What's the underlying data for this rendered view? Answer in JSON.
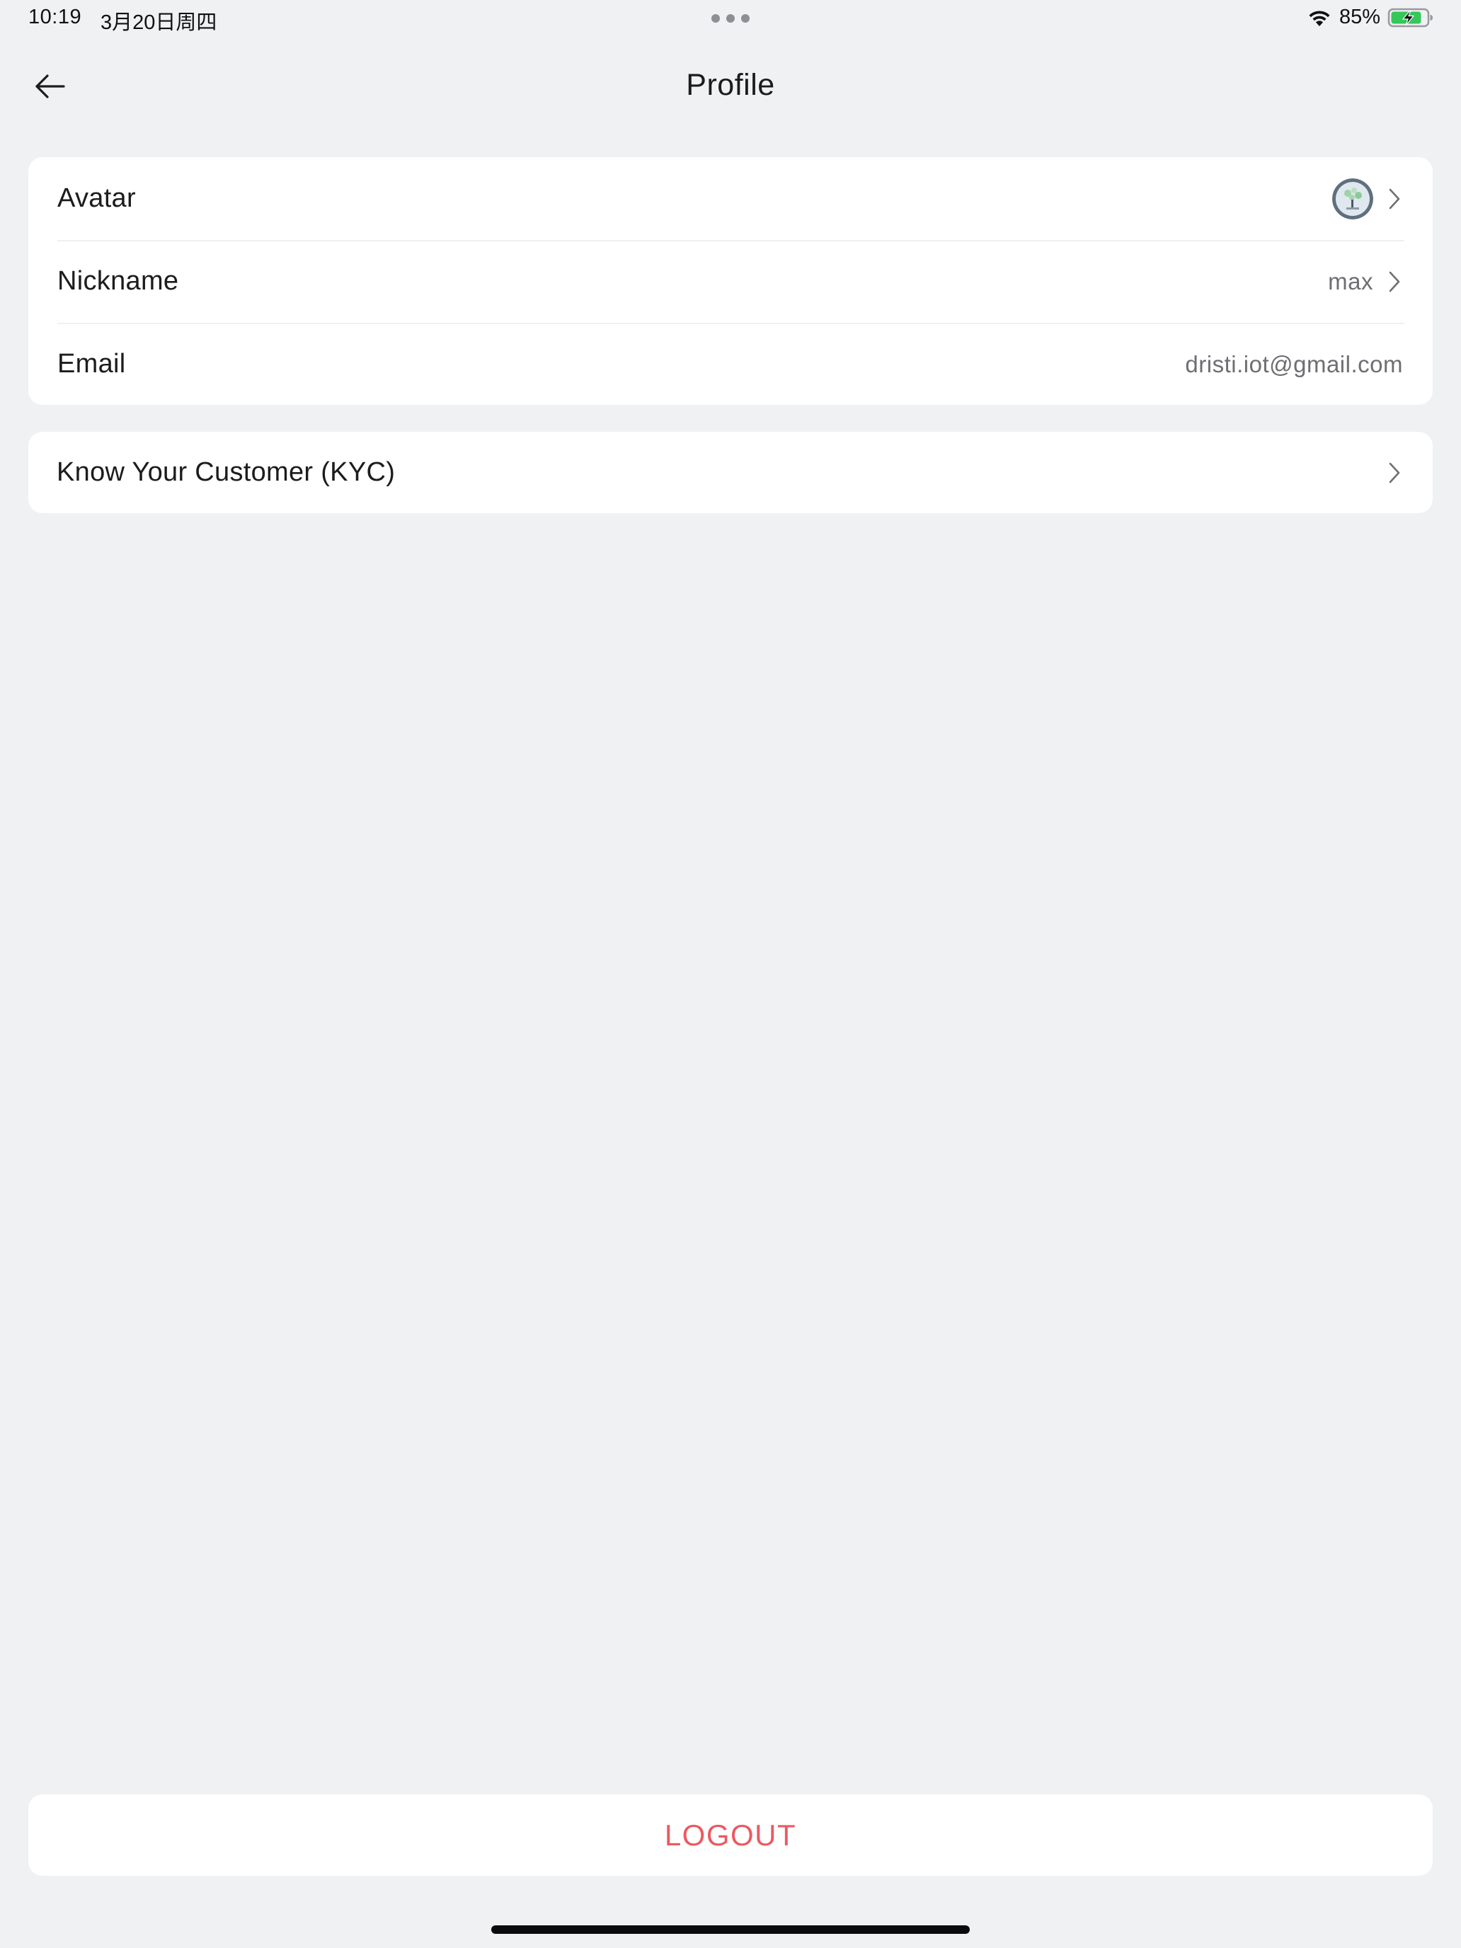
{
  "status_bar": {
    "time": "10:19",
    "date": "3月20日周四",
    "battery_percent": "85%",
    "battery_level": 0.85,
    "battery_color": "#34c759"
  },
  "nav": {
    "title": "Profile",
    "back_icon": "arrow-left-icon"
  },
  "profile_rows": [
    {
      "label": "Avatar",
      "value": "",
      "icon": "avatar-image"
    },
    {
      "label": "Nickname",
      "value": "max"
    },
    {
      "label": "Email",
      "value": "dristi.iot@gmail.com"
    }
  ],
  "kyc": {
    "label": "Know Your Customer (KYC)"
  },
  "logout": {
    "label": "LOGOUT",
    "color": "#ea5a62"
  }
}
